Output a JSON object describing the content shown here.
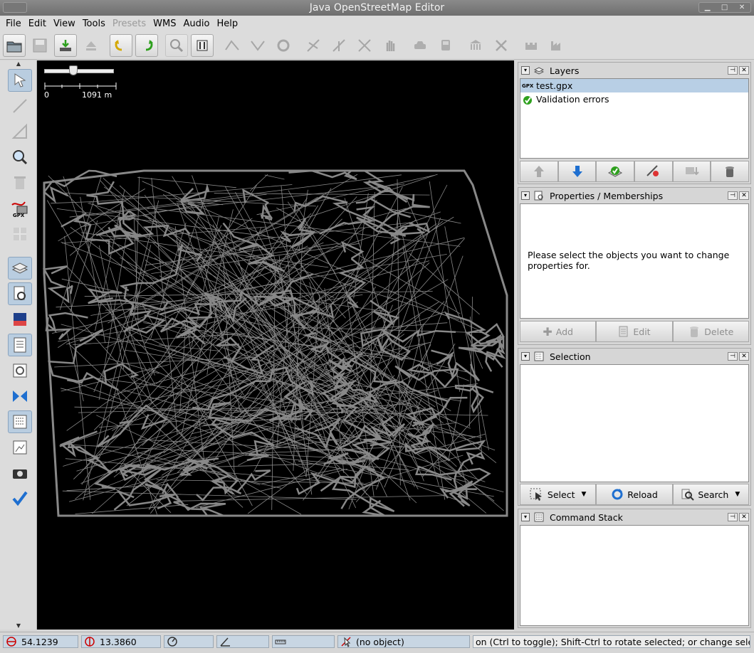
{
  "window": {
    "title": "Java OpenStreetMap Editor"
  },
  "menu": {
    "items": [
      {
        "label": "File",
        "disabled": false
      },
      {
        "label": "Edit",
        "disabled": false
      },
      {
        "label": "View",
        "disabled": false
      },
      {
        "label": "Tools",
        "disabled": false
      },
      {
        "label": "Presets",
        "disabled": true
      },
      {
        "label": "WMS",
        "disabled": false
      },
      {
        "label": "Audio",
        "disabled": false
      },
      {
        "label": "Help",
        "disabled": false
      }
    ]
  },
  "map": {
    "scale_start": "0",
    "scale_end": "1091 m",
    "track_color": "#888888",
    "background": "#000000"
  },
  "layers_panel": {
    "title": "Layers",
    "items": [
      {
        "badge": "GPX",
        "label": "test.gpx",
        "selected": true
      },
      {
        "badge": "",
        "label": "Validation errors",
        "selected": false
      }
    ]
  },
  "properties_panel": {
    "title": "Properties / Memberships",
    "message": "Please select the objects you want to change properties for.",
    "add_label": "Add",
    "edit_label": "Edit",
    "delete_label": "Delete"
  },
  "selection_panel": {
    "title": "Selection",
    "select_label": "Select",
    "reload_label": "Reload",
    "search_label": "Search"
  },
  "command_panel": {
    "title": "Command Stack"
  },
  "status": {
    "latitude": "54.1239",
    "longitude": "13.3860",
    "heading": "",
    "angle": "",
    "distance": "",
    "object": "(no object)",
    "help": "on (Ctrl to toggle); Shift-Ctrl to rotate selected; or change selection"
  },
  "colors": {
    "selection": "#b8cfe5",
    "status_field": "#c8d6e3",
    "accent_blue": "#1e6fd0",
    "accent_green": "#2ea01e"
  }
}
